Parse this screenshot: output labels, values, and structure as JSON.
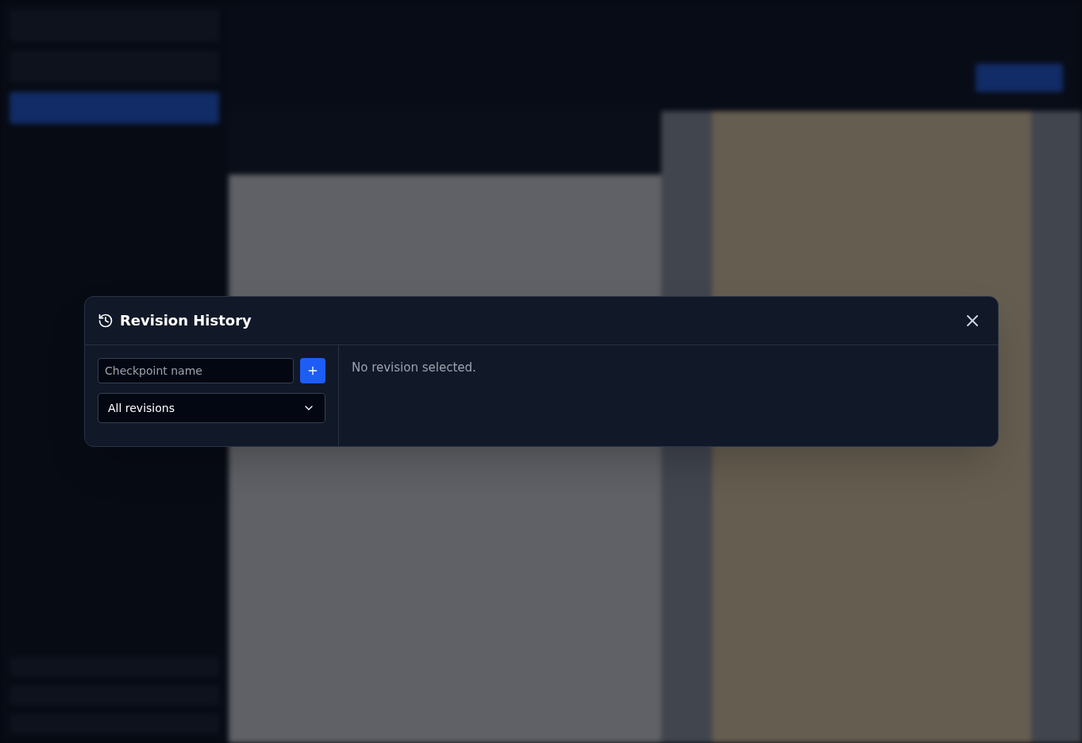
{
  "dialog": {
    "title": "Revision History",
    "checkpoint_field": {
      "placeholder": "Checkpoint name"
    },
    "filter_select": {
      "value": "All revisions"
    },
    "empty_message": "No revision selected."
  }
}
